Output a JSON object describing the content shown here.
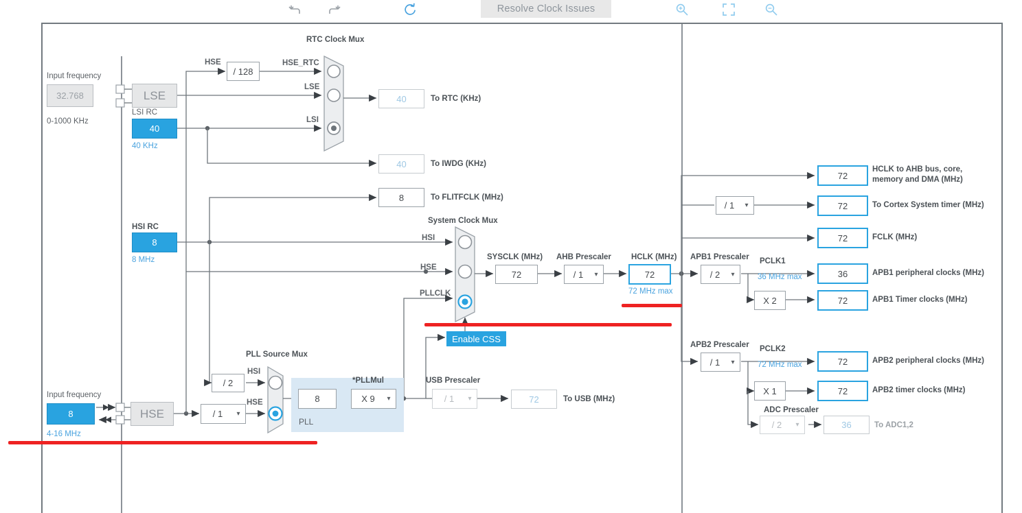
{
  "toolbar": {
    "undo_icon": "undo-arrow-icon",
    "redo_icon": "redo-arrow-icon",
    "refresh_icon": "refresh-icon",
    "resolve_label": "Resolve Clock Issues",
    "zoom_in_icon": "zoom-in-icon",
    "fit_icon": "fit-to-screen-icon",
    "zoom_out_icon": "zoom-out-icon"
  },
  "colors": {
    "accent": "#29a3e0",
    "error": "#ee2222",
    "wire": "#6e757b",
    "pll_panel": "#d9e8f4"
  },
  "lse": {
    "input_frequency_label": "Input frequency",
    "input_frequency_value": "32.768",
    "range": "0-1000 KHz",
    "osc_label": "LSE"
  },
  "lsi": {
    "title": "LSI RC",
    "value": "40",
    "unit": "40 KHz"
  },
  "hsi": {
    "title": "HSI RC",
    "value": "8",
    "unit": "8 MHz"
  },
  "hse": {
    "input_frequency_label": "Input frequency",
    "input_frequency_value": "8",
    "range": "4-16 MHz",
    "osc_label": "HSE",
    "prescaler_value": "/ 1"
  },
  "rtc_mux": {
    "title": "RTC Clock Mux",
    "inputs": [
      "HSE_RTC",
      "LSE",
      "LSI"
    ],
    "selected_index": 2,
    "hse_label": "HSE",
    "hse_divider": "/ 128"
  },
  "outputs_left": [
    {
      "name": "to-rtc",
      "value": "40",
      "label": "To RTC (KHz)",
      "enabled": false
    },
    {
      "name": "to-iwdg",
      "value": "40",
      "label": "To IWDG (KHz)",
      "enabled": false
    },
    {
      "name": "to-flitfclk",
      "value": "8",
      "label": "To FLITFCLK (MHz)",
      "enabled": true
    }
  ],
  "system_clock_mux": {
    "title": "System Clock Mux",
    "inputs": [
      "HSI",
      "HSE",
      "PLLCLK"
    ],
    "selected_index": 2,
    "css_button": "Enable CSS"
  },
  "pll_source_mux": {
    "title": "PLL Source Mux",
    "inputs": [
      "HSI",
      "HSE"
    ],
    "selected_index": 1,
    "hsi_divider": "/ 2"
  },
  "pll": {
    "panel_label": "PLL",
    "input_value": "8",
    "mul_label": "*PLLMul",
    "mul_value": "X 9"
  },
  "usb": {
    "prescaler_title": "USB Prescaler",
    "prescaler_value": "/ 1",
    "output_value": "72",
    "output_label": "To USB (MHz)",
    "enabled": false
  },
  "sysclk": {
    "title": "SYSCLK (MHz)",
    "value": "72"
  },
  "ahb_prescaler": {
    "title": "AHB Prescaler",
    "value": "/ 1"
  },
  "hclk": {
    "title": "HCLK (MHz)",
    "value": "72",
    "note": "72 MHz max"
  },
  "cortex_prescaler": {
    "value": "/ 1"
  },
  "hclk_outputs": [
    {
      "name": "hclk-ahb-bus",
      "value": "72",
      "label": "HCLK to AHB bus, core,",
      "label2": "memory and DMA (MHz)"
    },
    {
      "name": "cortex-system-timer",
      "value": "72",
      "label": "To Cortex System timer (MHz)"
    },
    {
      "name": "fclk",
      "value": "72",
      "label": "FCLK (MHz)"
    }
  ],
  "apb1": {
    "prescaler_title": "APB1 Prescaler",
    "prescaler_value": "/ 2",
    "pclk_label": "PCLK1",
    "max_note": "36 MHz max",
    "peripheral_value": "36",
    "peripheral_label": "APB1 peripheral clocks (MHz)",
    "timer_multiplier": "X 2",
    "timer_value": "72",
    "timer_label": "APB1 Timer clocks (MHz)"
  },
  "apb2": {
    "prescaler_title": "APB2 Prescaler",
    "prescaler_value": "/ 1",
    "pclk_label": "PCLK2",
    "max_note": "72 MHz max",
    "peripheral_value": "72",
    "peripheral_label": "APB2 peripheral clocks (MHz)",
    "timer_multiplier": "X 1",
    "timer_value": "72",
    "timer_label": "APB2 timer clocks (MHz)",
    "adc_prescaler_title": "ADC Prescaler",
    "adc_prescaler_value": "/ 2",
    "adc_value": "36",
    "adc_label": "To ADC1,2"
  }
}
